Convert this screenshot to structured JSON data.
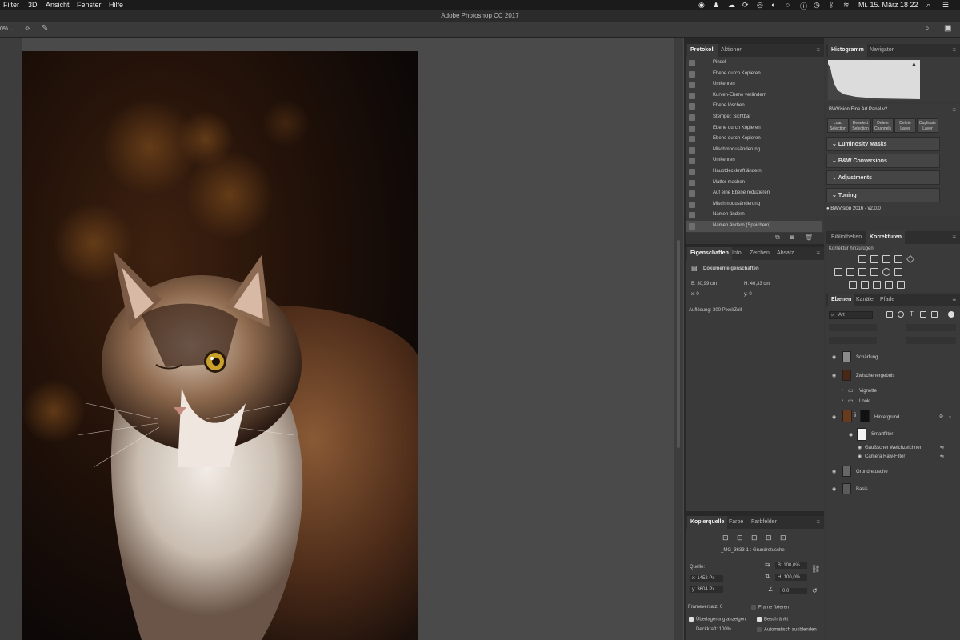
{
  "menubar": {
    "items": [
      "Filter",
      "3D",
      "Ansicht",
      "Fenster",
      "Hilfe"
    ],
    "datetime": "Mi. 15. März 18 22"
  },
  "window": {
    "title": "Adobe Photoshop CC 2017"
  },
  "options": {
    "zoom": "0%"
  },
  "history": {
    "tabs": [
      "Protokoll",
      "Aktionen"
    ],
    "items": [
      "Pinsel",
      "Ebene durch Kopieren",
      "Umkehren",
      "Kurven-Ebene verändern",
      "Ebene löschen",
      "Stempel: Sichtbar",
      "Ebene durch Kopieren",
      "Ebene durch Kopieren",
      "Mischmodusänderung",
      "Umkehren",
      "Hauptdeckkraft ändern",
      "Matter machen",
      "Auf eine Ebene reduzieren",
      "Mischmodusänderung",
      "Namen ändern",
      "Namen ändern (Speichern)"
    ]
  },
  "properties": {
    "tabs": [
      "Eigenschaften",
      "Info",
      "Zeichen",
      "Absatz"
    ],
    "doc_title": "Dokumenteigenschaften",
    "b": "B:  30,99 cm",
    "h": "H:  46,33 cm",
    "x": "x:  0",
    "y": "y:  0",
    "resolution": "Auflösung: 300 Pixel/Zoll"
  },
  "clone": {
    "tabs": [
      "Kopierquelle",
      "Farbe",
      "Farbfelder"
    ],
    "source_name": "_MG_3633-1 : Grundretusche",
    "quelle": "Quelle:",
    "x": "x:  1452 Px",
    "y": "y:  3604 Px",
    "w": "B:  100,0%",
    "h": "H:  100,0%",
    "angle": "0,0",
    "frame_offset": "Frameversatz:  0",
    "frame_lock": "Frame fixieren",
    "show_overlay": "Überlagerung anzeigen",
    "clipped": "Beschränkt",
    "opacity": "Deckkraft:  100%",
    "auto_hide": "Automatisch ausblenden"
  },
  "histogram": {
    "tabs": [
      "Histogramm",
      "Navigator"
    ]
  },
  "bwvision": {
    "title": "BWVision Fine Art Panel v2",
    "buttons": [
      {
        "l1": "Load",
        "l2": "Selection"
      },
      {
        "l1": "Deselect",
        "l2": "Selection"
      },
      {
        "l1": "Delete",
        "l2": "Channels"
      },
      {
        "l1": "Delete",
        "l2": "Layer"
      },
      {
        "l1": "Duplicate",
        "l2": "Layer"
      }
    ],
    "sections": [
      "Luminosity Masks",
      "B&W Conversions",
      "Adjustments",
      "Toning"
    ],
    "version": "BWVision 2016 - v2.0.0"
  },
  "libraries": {
    "tabs": [
      "Bibliotheken",
      "Korrekturen"
    ],
    "add_label": "Korrektur hinzufügen:"
  },
  "layers": {
    "tabs": [
      "Ebenen",
      "Kanäle",
      "Pfade"
    ],
    "filter": "Art",
    "items": [
      {
        "name": "Schärfung"
      },
      {
        "name": "Zwischenergebnis"
      },
      {
        "name": "Vignette"
      },
      {
        "name": "Look"
      },
      {
        "name": "Hintergrund"
      },
      {
        "name": "Smartfilter"
      },
      {
        "name": "Gaußscher Weichzeichner"
      },
      {
        "name": "Camera Raw-Filter"
      },
      {
        "name": "Grundretusche"
      },
      {
        "name": "Basis"
      }
    ]
  }
}
